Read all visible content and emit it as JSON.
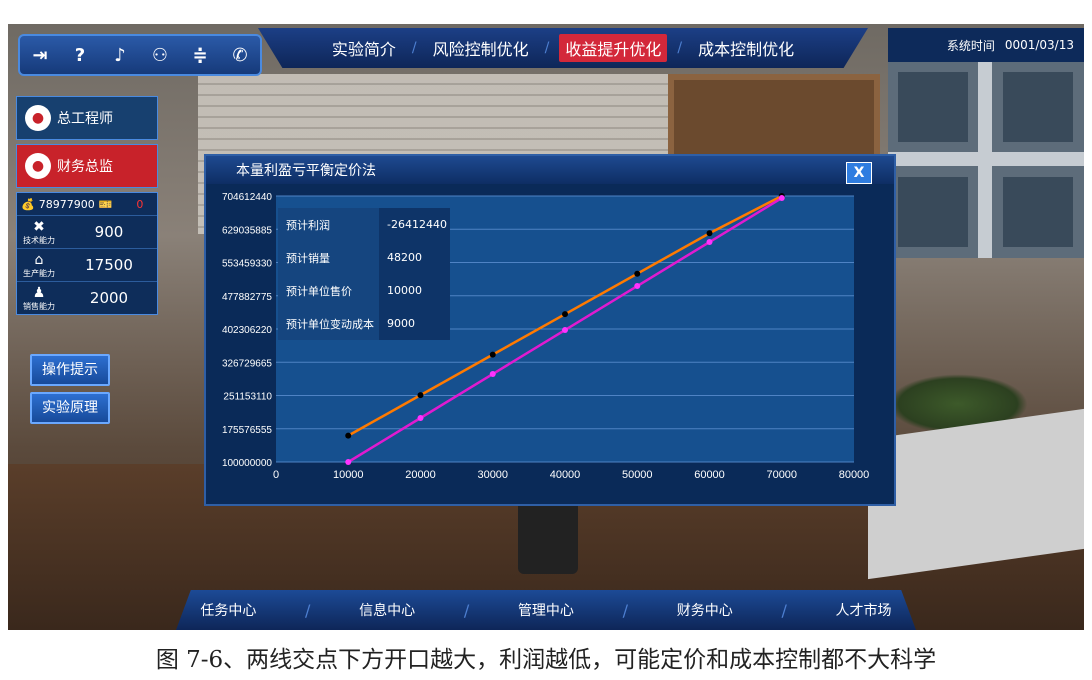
{
  "top_nav": {
    "tabs": [
      "实验简介",
      "风险控制优化",
      "收益提升优化",
      "成本控制优化"
    ],
    "active_index": 2,
    "icons": [
      "exit-icon",
      "help-icon",
      "music-icon",
      "user-icon",
      "settings-icon",
      "phone-icon"
    ],
    "icon_glyphs": [
      "⇥",
      "?",
      "♪",
      "⚇",
      "≑",
      "✆"
    ]
  },
  "clock": {
    "label": "系统时间",
    "value": "0001/03/13"
  },
  "roles": [
    {
      "label": "总工程师",
      "color": "#17406f"
    },
    {
      "label": "财务总监",
      "color": "#c8222a"
    }
  ],
  "stats": {
    "money": "78977900",
    "red_value": "0",
    "rows": [
      {
        "label": "技术能力",
        "value": "900"
      },
      {
        "label": "生产能力",
        "value": "17500"
      },
      {
        "label": "销售能力",
        "value": "2000"
      }
    ]
  },
  "buttons": {
    "tips": "操作提示",
    "principle": "实验原理"
  },
  "dialog": {
    "title": "本量利盈亏平衡定价法",
    "close": "X",
    "info": [
      {
        "key": "预计利润",
        "value": "-26412440"
      },
      {
        "key": "预计销量",
        "value": "48200"
      },
      {
        "key": "预计单位售价",
        "value": "10000"
      },
      {
        "key": "预计单位变动成本",
        "value": "9000"
      }
    ]
  },
  "chart_data": {
    "type": "line",
    "x_ticks": [
      0,
      10000,
      20000,
      30000,
      40000,
      50000,
      60000,
      70000,
      80000
    ],
    "y_ticks": [
      100000000,
      175576555,
      251153110,
      326729665,
      402306220,
      477882775,
      553459330,
      629035885,
      704612440
    ],
    "xlim": [
      0,
      80000
    ],
    "ylim": [
      100000000,
      704612440
    ],
    "grid": true,
    "series": [
      {
        "color": "#ff7a00",
        "point_color": "#000000",
        "x": [
          10000,
          20000,
          30000,
          40000,
          50000,
          60000,
          70000
        ],
        "y": [
          160000000,
          252000000,
          344000000,
          436000000,
          528000000,
          620000000,
          704612440
        ]
      },
      {
        "color": "#e01ad0",
        "point_color": "#ff33ff",
        "x": [
          10000,
          20000,
          30000,
          40000,
          50000,
          60000,
          70000
        ],
        "y": [
          100000000,
          200000000,
          300000000,
          400000000,
          500000000,
          600000000,
          700000000
        ]
      }
    ]
  },
  "bottom_nav": [
    "任务中心",
    "信息中心",
    "管理中心",
    "财务中心",
    "人才市场"
  ],
  "caption": "图 7-6、两线交点下方开口越大，利润越低，可能定价和成本控制都不大科学"
}
